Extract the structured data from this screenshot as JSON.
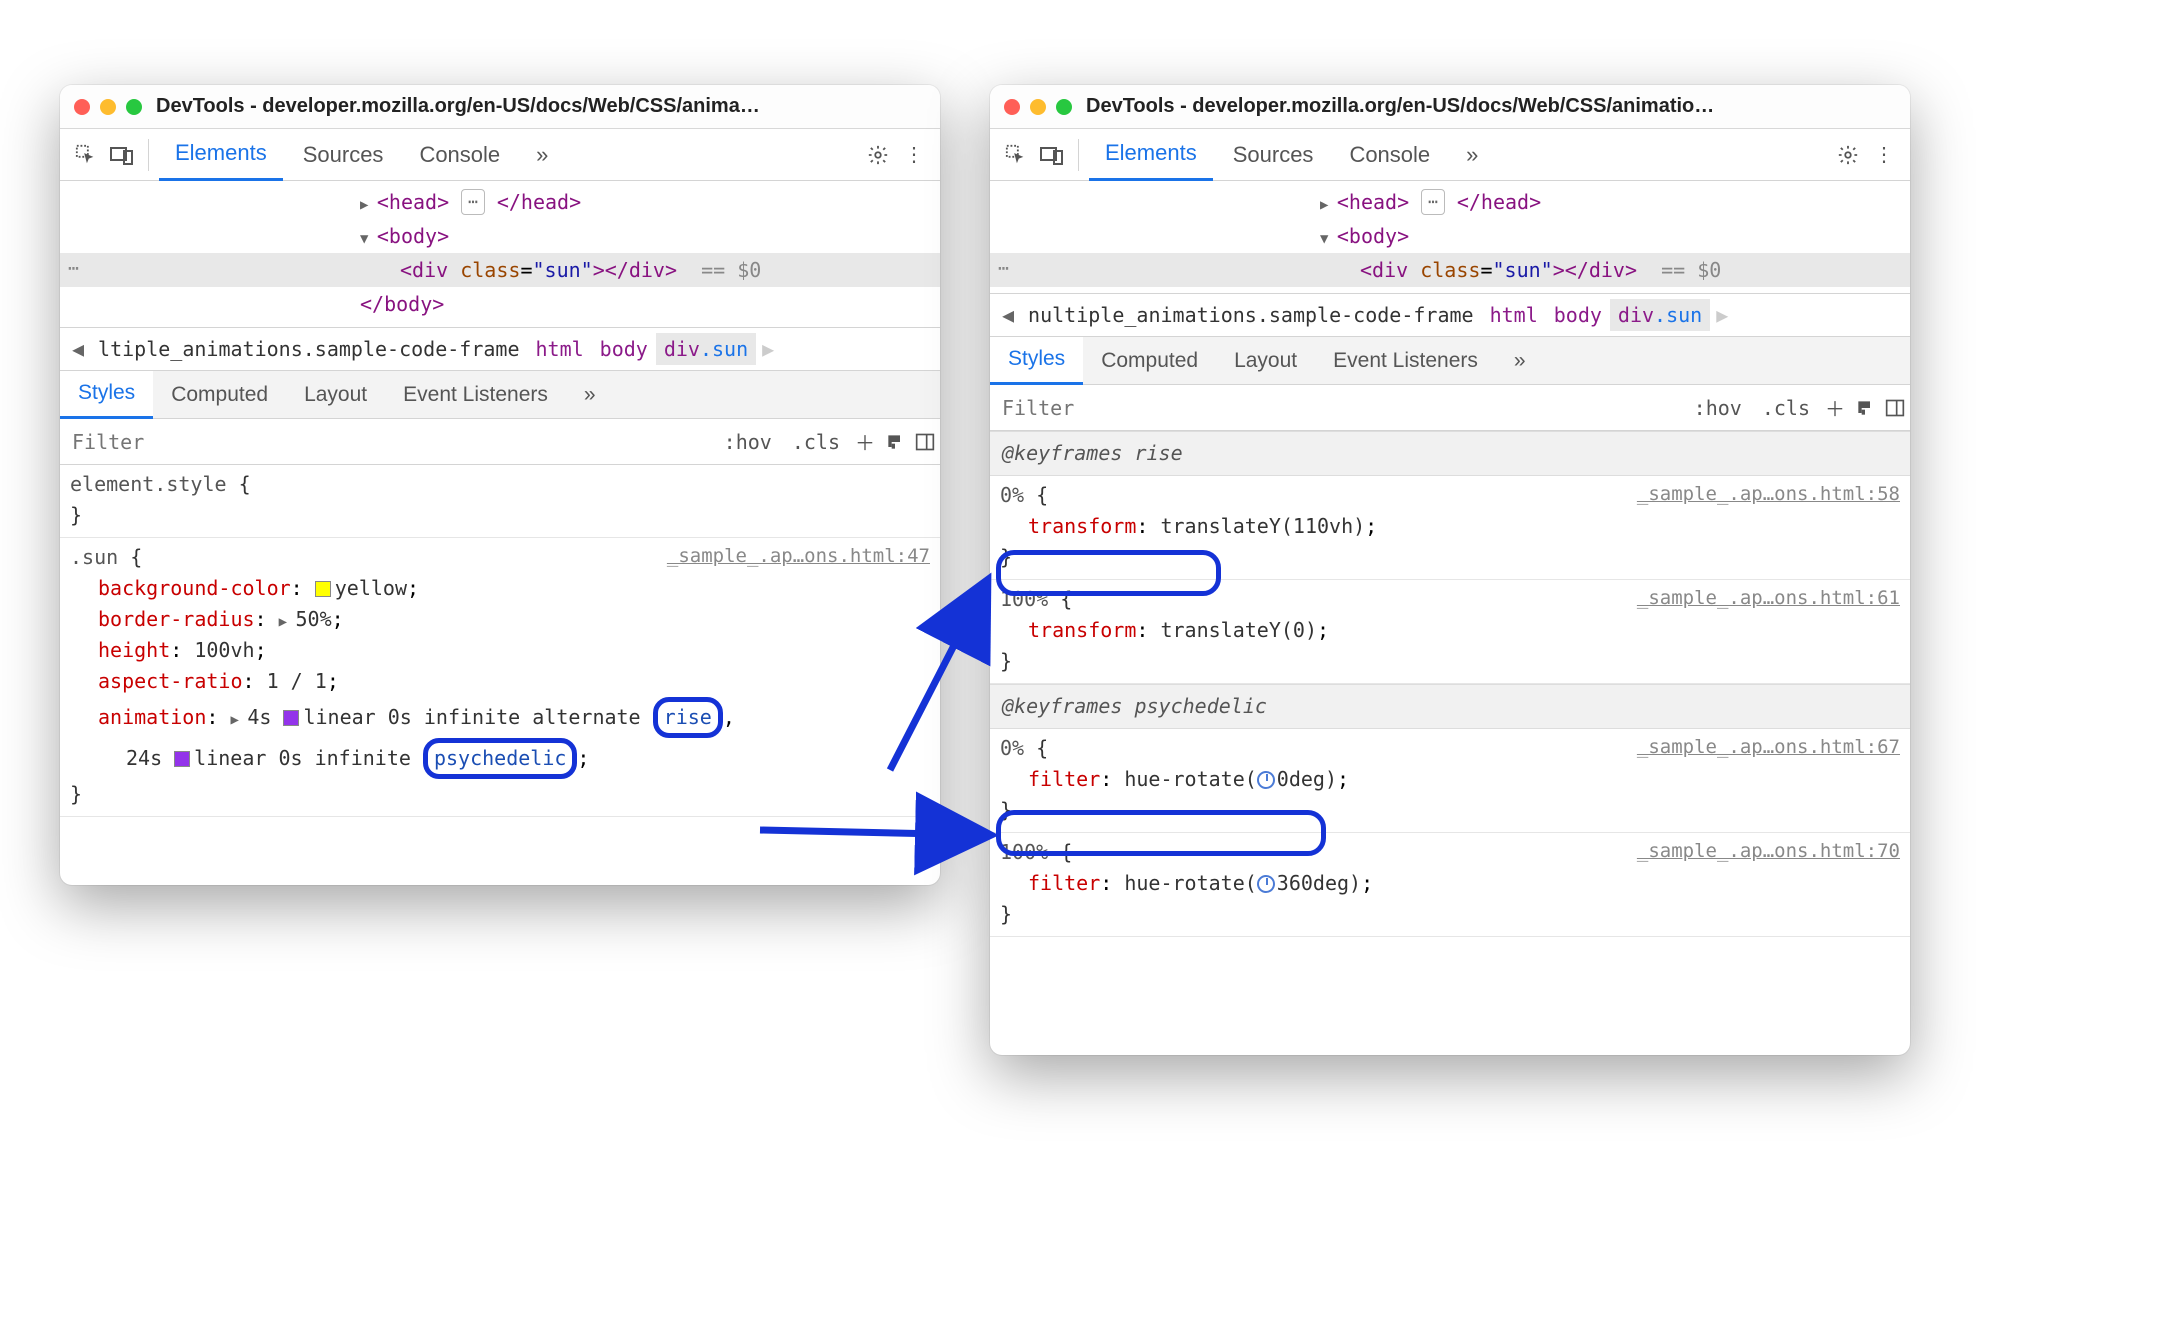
{
  "window_left": {
    "title": "DevTools - developer.mozilla.org/en-US/docs/Web/CSS/anima…",
    "tabs": {
      "elements": "Elements",
      "sources": "Sources",
      "console": "Console"
    },
    "dom": {
      "head_open": "<head>",
      "head_close": "</head>",
      "body_open": "<body>",
      "div_open": "<div ",
      "div_class_attr": "class",
      "div_class_val": "\"sun\"",
      "div_close": "></div>",
      "eq0": "== $0",
      "body_close": "</body>"
    },
    "breadcrumb": {
      "frame_prefix": "ltiple_animations.",
      "frame_cls": "sample-code-frame",
      "html": "html",
      "body": "body",
      "divsun": "div.sun"
    },
    "subtabs": {
      "styles": "Styles",
      "computed": "Computed",
      "layout": "Layout",
      "listeners": "Event Listeners"
    },
    "filter": {
      "placeholder": "Filter",
      "hov": ":hov",
      "cls": ".cls"
    },
    "rule_element": {
      "selector": "element.style",
      "open": "{",
      "close": "}"
    },
    "rule_sun": {
      "selector": ".sun",
      "open": "{",
      "close": "}",
      "src": "_sample_.ap…ons.html:47",
      "props": {
        "bg": "background-color",
        "bg_val": "yellow",
        "br": "border-radius",
        "br_val": "50%",
        "h": "height",
        "h_val": "100vh",
        "ar": "aspect-ratio",
        "ar_val": "1 / 1",
        "anim": "animation",
        "anim_val1_a": "4s ",
        "anim_val1_b": "linear 0s infinite alternate ",
        "anim_link1": "rise",
        "anim_val2_a": "24s ",
        "anim_val2_b": "linear 0s infinite ",
        "anim_link2": "psychedelic"
      }
    }
  },
  "window_right": {
    "title": "DevTools - developer.mozilla.org/en-US/docs/Web/CSS/animatio…",
    "tabs": {
      "elements": "Elements",
      "sources": "Sources",
      "console": "Console"
    },
    "dom": {
      "head_open": "<head>",
      "head_close": "</head>",
      "body_open": "<body>",
      "div_open": "<div ",
      "div_class_attr": "class",
      "div_class_val": "\"sun\"",
      "div_close": "></div>",
      "eq0": "== $0",
      "body_close": "</body>"
    },
    "breadcrumb": {
      "frame_prefix": "nultiple_animations.",
      "frame_cls": "sample-code-frame",
      "html": "html",
      "body": "body",
      "divsun": "div.sun"
    },
    "subtabs": {
      "styles": "Styles",
      "computed": "Computed",
      "layout": "Layout",
      "listeners": "Event Listeners"
    },
    "filter": {
      "placeholder": "Filter",
      "hov": ":hov",
      "cls": ".cls"
    },
    "kf_rise": {
      "header": "@keyframes rise",
      "p0": "0%",
      "p0src": "_sample_.ap…ons.html:58",
      "p0_prop": "transform",
      "p0_val": "translateY(110vh)",
      "p100": "100%",
      "p100src": "_sample_.ap…ons.html:61",
      "p100_prop": "transform",
      "p100_val": "translateY(0)"
    },
    "kf_psy": {
      "header": "@keyframes psychedelic",
      "p0": "0%",
      "p0src": "_sample_.ap…ons.html:67",
      "p0_prop": "filter",
      "p0_val": "hue-rotate(",
      "p0_val2": "0deg)",
      "p100": "100%",
      "p100src": "_sample_.ap…ons.html:70",
      "p100_prop": "filter",
      "p100_val": "hue-rotate(",
      "p100_val2": "360deg)"
    }
  },
  "glyphs": {
    "more": "»",
    "left": "◀",
    "right": "▶"
  }
}
